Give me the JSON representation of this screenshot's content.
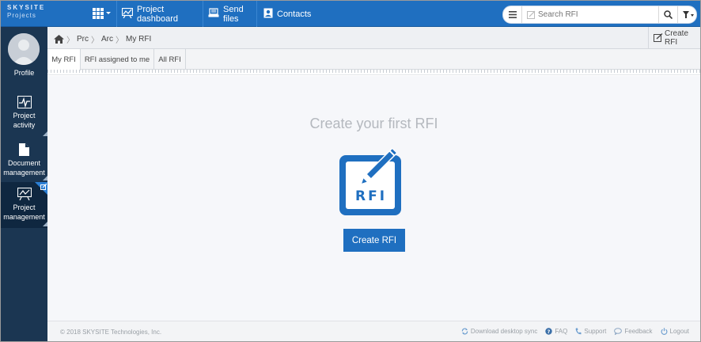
{
  "brand": {
    "line1": "SKYSITE",
    "line2": "Projects"
  },
  "topnav": {
    "dashboard": "Project dashboard",
    "send_files": "Send files",
    "contacts": "Contacts"
  },
  "search": {
    "placeholder": "Search RFI"
  },
  "sidebar": {
    "profile": "Profile",
    "activity_line1": "Project",
    "activity_line2": "activity",
    "docs_line1": "Document",
    "docs_line2": "management",
    "pm_line1": "Project",
    "pm_line2": "management"
  },
  "breadcrumb": {
    "items": [
      "Prc",
      "Arc",
      "My RFI"
    ]
  },
  "create_rfi_top": "Create RFI",
  "subtabs": {
    "my": "My RFI",
    "assigned": "RFI assigned to me",
    "all": "All RFI",
    "active": "my"
  },
  "empty_state": {
    "title": "Create your first RFI",
    "icon_text": "RFI",
    "button": "Create RFI"
  },
  "footer": {
    "copyright": "© 2018 SKYSITE Technologies, Inc.",
    "download_sync": "Download desktop sync",
    "faq": "FAQ",
    "support": "Support",
    "feedback": "Feedback",
    "logout": "Logout"
  },
  "colors": {
    "primary": "#1f6fc0",
    "sidebar": "#1b3652",
    "sidebar_active": "#0f2740"
  }
}
